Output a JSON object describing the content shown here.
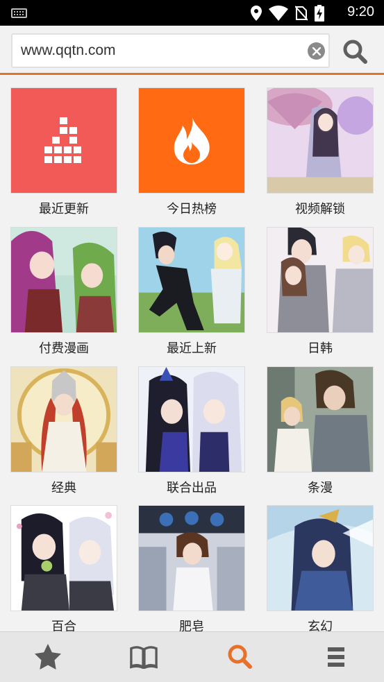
{
  "statusbar": {
    "time": "9:20"
  },
  "search": {
    "url": "www.qqtn.com"
  },
  "colors": {
    "accent": "#e8712a",
    "tile_red": "#f25a57",
    "tile_orange": "#ff6a13"
  },
  "grid": {
    "items": [
      {
        "label": "最近更新",
        "icon": "grid-blocks-icon"
      },
      {
        "label": "今日热榜",
        "icon": "flame-icon"
      },
      {
        "label": "视频解锁",
        "icon": "cover-art"
      },
      {
        "label": "付费漫画",
        "icon": "cover-art"
      },
      {
        "label": "最近上新",
        "icon": "cover-art"
      },
      {
        "label": "日韩",
        "icon": "cover-art"
      },
      {
        "label": "经典",
        "icon": "cover-art"
      },
      {
        "label": "联合出品",
        "icon": "cover-art"
      },
      {
        "label": "条漫",
        "icon": "cover-art"
      },
      {
        "label": "百合",
        "icon": "cover-art"
      },
      {
        "label": "肥皂",
        "icon": "cover-art"
      },
      {
        "label": "玄幻",
        "icon": "cover-art"
      }
    ]
  },
  "bottomnav": {
    "items": [
      {
        "icon": "star-icon",
        "active": false
      },
      {
        "icon": "book-icon",
        "active": false
      },
      {
        "icon": "search-icon",
        "active": true
      },
      {
        "icon": "menu-icon",
        "active": false
      }
    ]
  }
}
